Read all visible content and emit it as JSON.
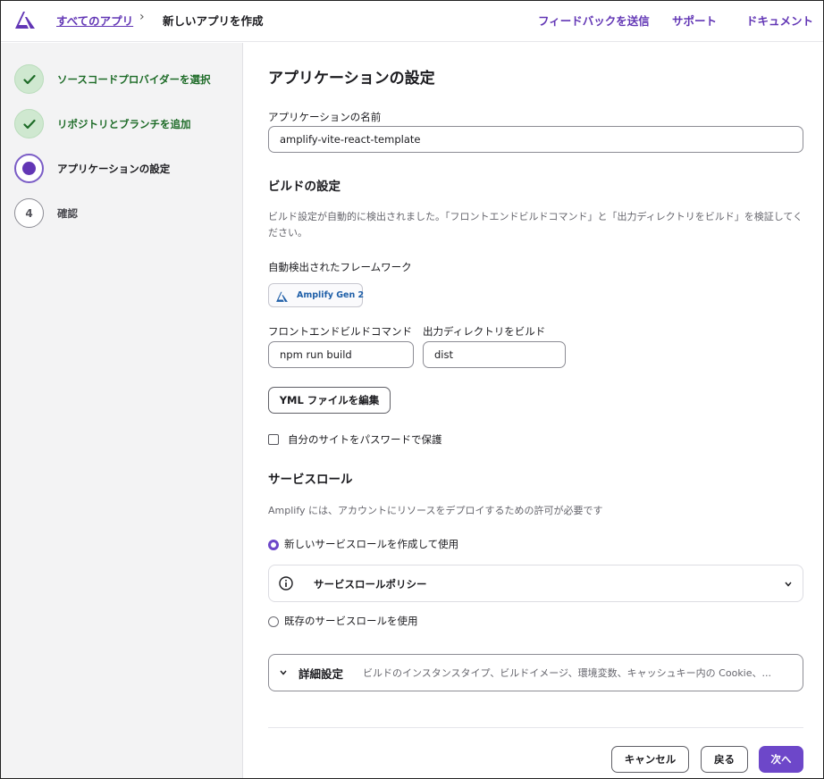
{
  "header": {
    "breadcrumb_link": "すべてのアプリ",
    "breadcrumb_sep": "›",
    "breadcrumb_current": "新しいアプリを作成",
    "links": [
      "フィードバックを送信",
      "サポート",
      "ドキュメント"
    ]
  },
  "sidebar": {
    "steps": [
      {
        "label": "ソースコードプロバイダーを選択",
        "state": "done"
      },
      {
        "label": "リポジトリとブランチを追加",
        "state": "done"
      },
      {
        "label": "アプリケーションの設定",
        "state": "current"
      },
      {
        "label": "確認",
        "state": "pending",
        "number": "4"
      }
    ]
  },
  "main": {
    "title": "アプリケーションの設定",
    "app_name_label": "アプリケーションの名前",
    "app_name_value": "amplify-vite-react-template",
    "build_title": "ビルドの設定",
    "build_desc": "ビルド設定が自動的に検出されました。「フロントエンドビルドコマンド」と「出力ディレクトリをビルド」を検証してください。",
    "framework_label": "自動検出されたフレームワーク",
    "framework_name": "Amplify Gen 2",
    "frontend_cmd_label": "フロントエンドビルドコマンド",
    "frontend_cmd_value": "npm run build",
    "output_dir_label": "出力ディレクトリをビルド",
    "output_dir_value": "dist",
    "edit_yml_button": "YML ファイルを編集",
    "password_protect_label": "自分のサイトをパスワードで保護",
    "service_role_title": "サービスロール",
    "service_role_desc": "Amplify には、アカウントにリソースをデプロイするための許可が必要です",
    "radio_new_role": "新しいサービスロールを作成して使用",
    "service_role_policy": "サービスロールポリシー",
    "radio_existing_role": "既存のサービスロールを使用",
    "advanced_title": "詳細設定",
    "advanced_desc": "ビルドのインスタンスタイプ、ビルドイメージ、環境変数、キャッシュキー内の Cookie、...",
    "cancel_button": "キャンセル",
    "back_button": "戻る",
    "next_button": "次へ"
  },
  "colors": {
    "accent": "#6d47c9",
    "link": "#6236b5",
    "success": "#1d6b27"
  }
}
